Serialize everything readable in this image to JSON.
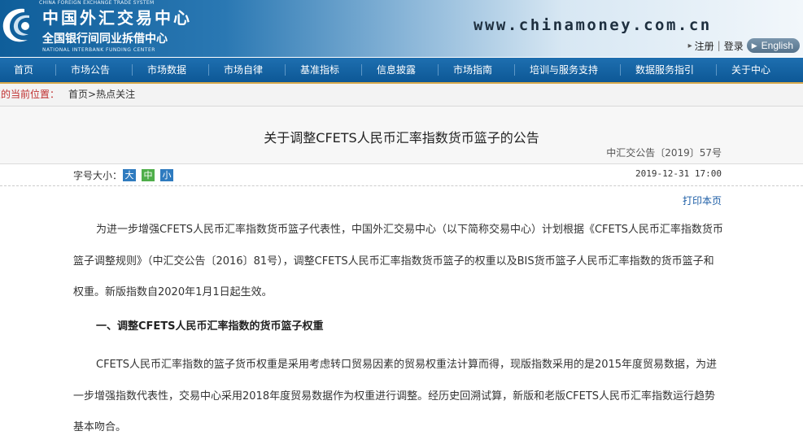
{
  "header": {
    "brand_en_top": "CHINA FOREIGN EXCHANGE TRADE SYSTEM",
    "brand_cn_main": "中国外汇交易中心",
    "brand_cn_sub": "全国银行间同业拆借中心",
    "brand_en_bottom": "NATIONAL INTERBANK FUNDING CENTER",
    "site_url": "www.chinamoney.com.cn",
    "register_label": "注册",
    "login_label": "登录",
    "language_label": "English"
  },
  "nav": {
    "items": [
      "首页",
      "市场公告",
      "市场数据",
      "市场自律",
      "基准指标",
      "信息披露",
      "市场指南",
      "培训与服务支持",
      "数据服务指引",
      "关于中心"
    ]
  },
  "breadcrumb": {
    "label": "您的当前位置：",
    "home": "首页",
    "separator": ">",
    "current": "热点关注"
  },
  "article": {
    "title": "关于调整CFETS人民币汇率指数货币篮子的公告",
    "doc_number": "中汇交公告〔2019〕57号",
    "font_size_label": "字号大小：",
    "font_size_options": [
      "大",
      "中",
      "小"
    ],
    "date": "2019-12-31 17:00",
    "print_label": "打印本页",
    "paragraph_1": "为进一步增强CFETS人民币汇率指数货币篮子代表性，中国外汇交易中心（以下简称交易中心）计划根据《CFETS人民币汇率指数货币篮子调整规则》（中汇交公告〔2016〕81号），调整CFETS人民币汇率指数货币篮子的权重以及BIS货币篮子人民币汇率指数的货币篮子和权重。新版指数自2020年1月1日起生效。",
    "section_heading": "一、调整CFETS人民币汇率指数的货币篮子权重",
    "paragraph_2": "CFETS人民币汇率指数的篮子货币权重是采用考虑转口贸易因素的贸易权重法计算而得，现版指数采用的是2015年度贸易数据，为进一步增强指数代表性，交易中心采用2018年度贸易数据作为权重进行调整。经历史回溯试算，新版和老版CFETS人民币汇率指数运行趋势基本吻合。"
  },
  "colors": {
    "nav_bg": "#1565a8",
    "nav_underline": "#d6a84a",
    "font_large": "#2f7bbf",
    "font_medium": "#4fae4a",
    "font_small": "#2f7bbf",
    "breadcrumb_label": "#c03030",
    "link": "#1d5ea6"
  }
}
